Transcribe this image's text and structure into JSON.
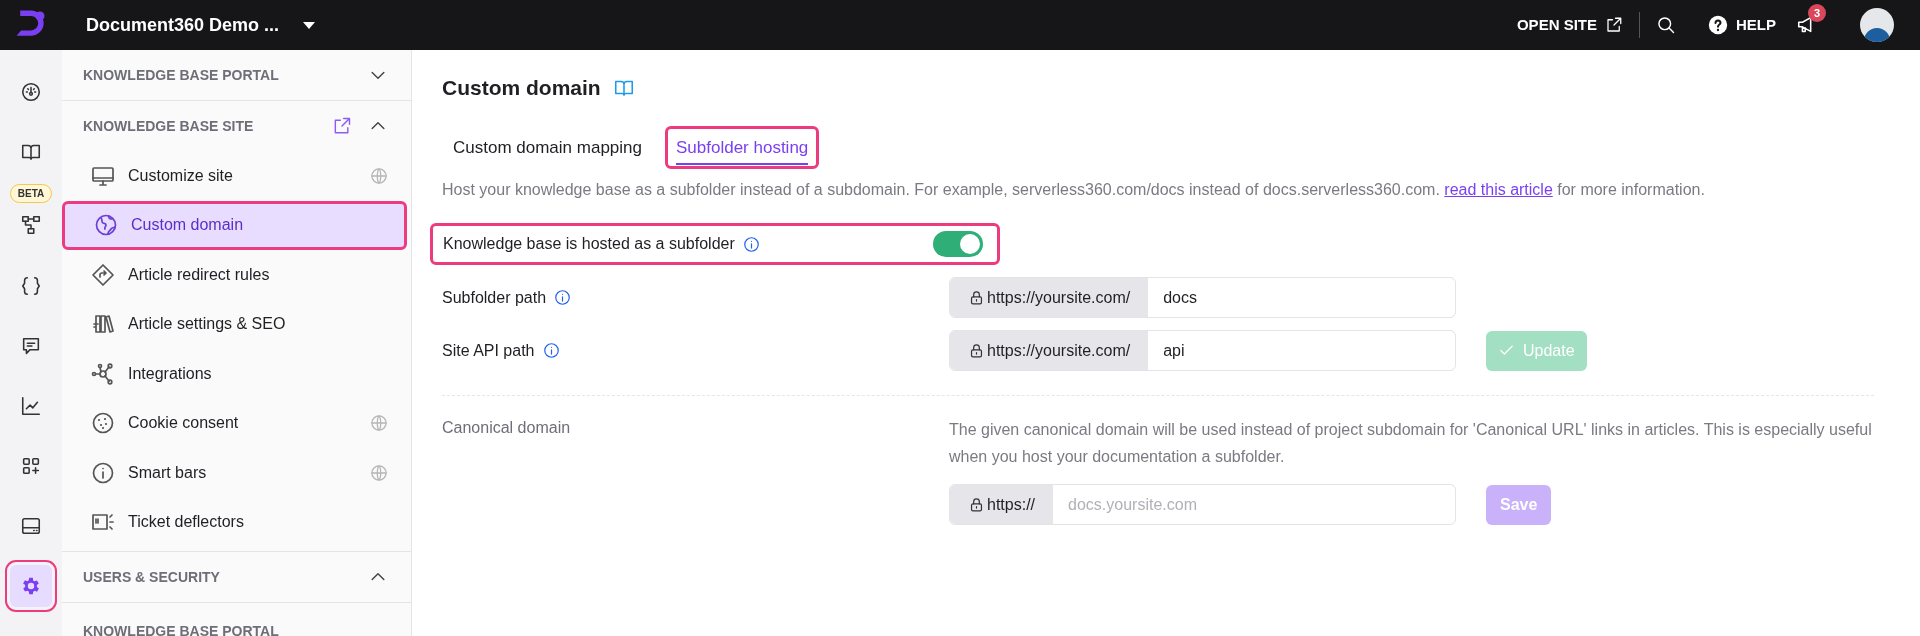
{
  "topbar": {
    "project": "Document360 Demo ...",
    "open_site": "OPEN SITE",
    "help": "HELP",
    "notifications": "3"
  },
  "rail": [
    {
      "selected": false,
      "highlighted": false
    },
    {
      "selected": false,
      "highlighted": false
    },
    {
      "selected": false,
      "highlighted": false,
      "badge": "BETA"
    },
    {
      "selected": false,
      "highlighted": false
    },
    {
      "selected": false,
      "highlighted": false
    },
    {
      "selected": false,
      "highlighted": false
    },
    {
      "selected": false,
      "highlighted": false
    },
    {
      "selected": false,
      "highlighted": false
    },
    {
      "selected": true,
      "highlighted": true
    }
  ],
  "sidebar": {
    "sections": [
      {
        "title": "KNOWLEDGE BASE PORTAL",
        "expanded": false,
        "external": false
      },
      {
        "title": "KNOWLEDGE BASE SITE",
        "expanded": true,
        "external": true,
        "items": [
          {
            "label": "Customize site",
            "globe": true,
            "selected": false,
            "highlighted": false
          },
          {
            "label": "Custom domain",
            "globe": false,
            "selected": true,
            "highlighted": true
          },
          {
            "label": "Article redirect rules",
            "globe": false,
            "selected": false,
            "highlighted": false
          },
          {
            "label": "Article settings & SEO",
            "globe": false,
            "selected": false,
            "highlighted": false
          },
          {
            "label": "Integrations",
            "globe": false,
            "selected": false,
            "highlighted": false
          },
          {
            "label": "Cookie consent",
            "globe": true,
            "selected": false,
            "highlighted": false
          },
          {
            "label": "Smart bars",
            "globe": true,
            "selected": false,
            "highlighted": false
          },
          {
            "label": "Ticket deflectors",
            "globe": false,
            "selected": false,
            "highlighted": false
          }
        ]
      },
      {
        "title": "USERS & SECURITY",
        "expanded": true,
        "external": false
      }
    ],
    "trailing": "KNOWLEDGE BASE PORTAL"
  },
  "main": {
    "title": "Custom domain",
    "tabs": [
      {
        "label": "Custom domain mapping",
        "selected": false,
        "highlighted": false
      },
      {
        "label": "Subfolder hosting",
        "selected": true,
        "highlighted": true
      }
    ],
    "description": "Host your knowledge base as a subfolder instead of a subdomain. For example, serverless360.com/docs instead of docs.serverless360.com.",
    "link": "read this article",
    "description_end": "for more information.",
    "toggle": {
      "label": "Knowledge base is hosted as a subfolder",
      "on": true,
      "highlighted": true
    },
    "paths": [
      {
        "label": "Subfolder path",
        "prefix": "https://yoursite.com/",
        "value": "docs"
      },
      {
        "label": "Site API path",
        "prefix": "https://yoursite.com/",
        "value": "api"
      }
    ],
    "update_button": "Update",
    "canonical": {
      "label": "Canonical domain",
      "description": "The given canonical domain will be used instead of project subdomain for 'Canonical URL' links in articles. This is especially useful when you host your documentation a subfolder.",
      "prefix": "https://",
      "placeholder": "docs.yoursite.com",
      "button": "Save"
    }
  }
}
